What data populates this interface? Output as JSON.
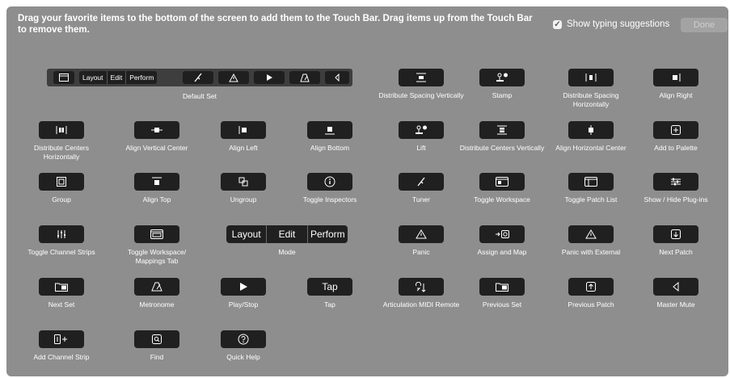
{
  "header": {
    "instructions": "Drag your favorite items to the bottom of the screen to add them to the Touch Bar. Drag items up from the Touch Bar to remove them.",
    "show_typing_suggestions_label": "Show typing suggestions",
    "show_typing_suggestions_checked": true,
    "done_label": "Done"
  },
  "default_set": {
    "label": "Default Set",
    "segments": [
      "Layout",
      "Edit",
      "Perform"
    ],
    "icons": [
      "window-icon",
      "tuner-icon",
      "warning-icon",
      "play-icon",
      "metronome-icon",
      "speaker-icon"
    ]
  },
  "mode": {
    "label": "Mode",
    "segments": [
      "Layout",
      "Edit",
      "Perform"
    ]
  },
  "items": [
    {
      "label": "Distribute Spacing Vertically",
      "icon": "distribute-spacing-vertically-icon"
    },
    {
      "label": "Stamp",
      "icon": "stamp-icon"
    },
    {
      "label": "Distribute Spacing Horizontally",
      "icon": "distribute-spacing-horizontally-icon"
    },
    {
      "label": "Align Right",
      "icon": "align-right-icon"
    },
    {
      "label": "Distribute Centers Horizontally",
      "icon": "distribute-centers-horizontally-icon"
    },
    {
      "label": "Align Vertical Center",
      "icon": "align-vertical-center-icon"
    },
    {
      "label": "Align Left",
      "icon": "align-left-icon"
    },
    {
      "label": "Align Bottom",
      "icon": "align-bottom-icon"
    },
    {
      "label": "Lift",
      "icon": "lift-icon"
    },
    {
      "label": "Distribute Centers Vertically",
      "icon": "distribute-centers-vertically-icon"
    },
    {
      "label": "Align Horizontal Center",
      "icon": "align-horizontal-center-icon"
    },
    {
      "label": "Add to Palette",
      "icon": "add-to-palette-icon"
    },
    {
      "label": "Group",
      "icon": "group-icon"
    },
    {
      "label": "Align Top",
      "icon": "align-top-icon"
    },
    {
      "label": "Ungroup",
      "icon": "ungroup-icon"
    },
    {
      "label": "Toggle Inspectors",
      "icon": "info-icon"
    },
    {
      "label": "Tuner",
      "icon": "tuner-icon"
    },
    {
      "label": "Toggle Workspace",
      "icon": "workspace-icon"
    },
    {
      "label": "Toggle Patch List",
      "icon": "patch-list-icon"
    },
    {
      "label": "Show / Hide Plug-ins",
      "icon": "plug-ins-icon"
    },
    {
      "label": "Toggle Channel Strips",
      "icon": "channel-strips-icon"
    },
    {
      "label": "Toggle Workspace/ Mappings Tab",
      "icon": "mappings-tab-icon"
    },
    {
      "label": "Panic",
      "icon": "warning-icon"
    },
    {
      "label": "Assign and Map",
      "icon": "assign-map-icon"
    },
    {
      "label": "Panic with External",
      "icon": "warning-icon"
    },
    {
      "label": "Next Patch",
      "icon": "next-patch-icon"
    },
    {
      "label": "Next Set",
      "icon": "next-set-icon"
    },
    {
      "label": "Metronome",
      "icon": "metronome-icon"
    },
    {
      "label": "Play/Stop",
      "icon": "play-icon"
    },
    {
      "label": "Tap",
      "icon": "tap-text",
      "button_text": "Tap"
    },
    {
      "label": "Articulation MIDI Remote",
      "icon": "articulation-icon"
    },
    {
      "label": "Previous Set",
      "icon": "previous-set-icon"
    },
    {
      "label": "Previous Patch",
      "icon": "previous-patch-icon"
    },
    {
      "label": "Master Mute",
      "icon": "speaker-icon"
    },
    {
      "label": "Add Channel Strip",
      "icon": "add-channel-strip-icon"
    },
    {
      "label": "Find",
      "icon": "find-icon"
    },
    {
      "label": "Quick Help",
      "icon": "help-icon"
    }
  ]
}
